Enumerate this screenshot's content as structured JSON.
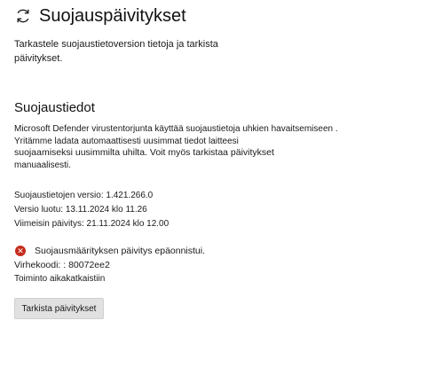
{
  "header": {
    "title": "Suojauspäivitykset",
    "icon": "refresh-icon"
  },
  "subtitle": "Tarkastele suojaustietoversion tietoja ja tarkista päivitykset.",
  "section": {
    "title": "Suojaustiedot",
    "description_lines": [
      "Microsoft Defender virustentorjunta käyttää suojaustietoja uhkien havaitsemiseen .",
      "Yritämme ladata automaattisesti uusimmat tiedot laitteesi",
      "suojaamiseksi uusimmilta uhilta. Voit myös tarkistaa päivitykset",
      "manuaalisesti."
    ]
  },
  "info": {
    "version": "Suojaustietojen versio: 1.421.266.0",
    "created": "Versio luotu: 13.11.2024 klo 11.26",
    "last_update": "Viimeisin päivitys: 21.11.2024 klo 12.00"
  },
  "error": {
    "icon": "error-icon",
    "color": "#c42b1c",
    "message": "Suojausmäärityksen päivitys epäonnistui.",
    "code": "Virhekoodi: : 80072ee2",
    "action": "Toiminto aikakatkaistiin"
  },
  "button": {
    "label": "Tarkista päivitykset"
  }
}
